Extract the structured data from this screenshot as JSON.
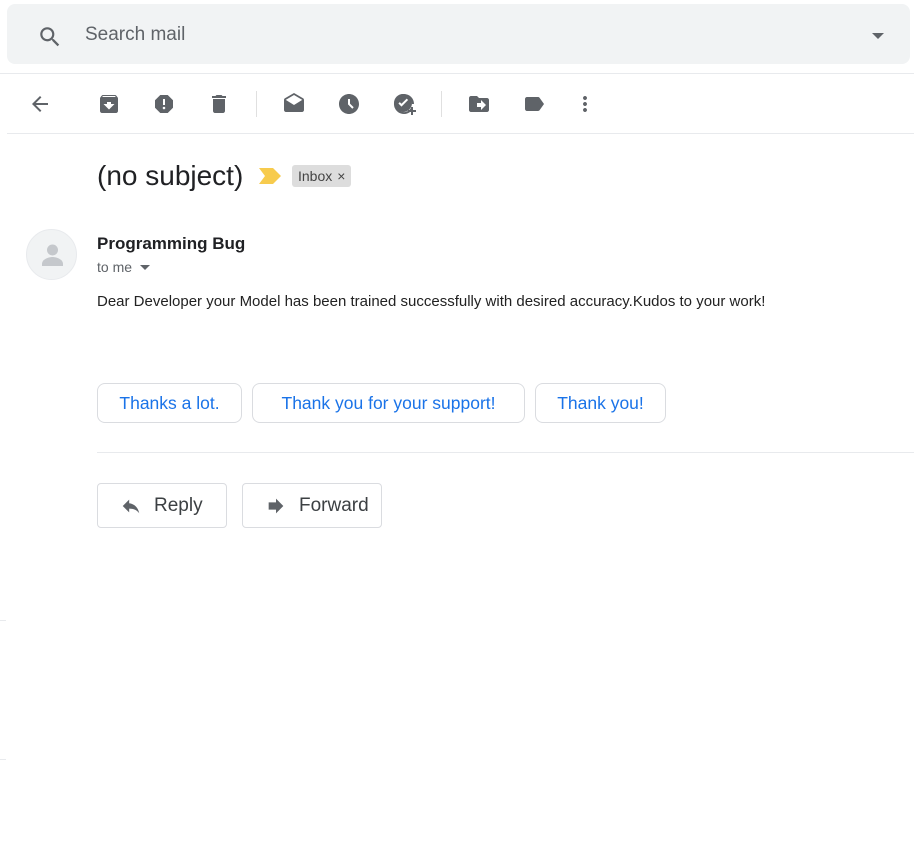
{
  "search": {
    "placeholder": "Search mail",
    "icon": "search-icon",
    "options_icon": "chevron-down-icon"
  },
  "toolbar": {
    "back": "arrow-back-icon",
    "actions": [
      "archive-icon",
      "report-spam-icon",
      "delete-icon",
      "mark-unread-icon",
      "snooze-icon",
      "add-task-icon",
      "move-to-icon",
      "label-icon",
      "more-vert-icon"
    ]
  },
  "message": {
    "subject": "(no subject)",
    "label": "Inbox",
    "label_remove": "×",
    "sender": "Programming Bug",
    "recipient": "to me",
    "body": "Dear Developer your Model has been trained successfully with desired accuracy.Kudos to your work!"
  },
  "smart_replies": [
    "Thanks a lot.",
    "Thank you for your support!",
    "Thank you!"
  ],
  "actions": {
    "reply": "Reply",
    "forward": "Forward"
  },
  "colors": {
    "accent": "#1a73e8",
    "importance": "#f7cb4d",
    "icon": "#5f6368"
  }
}
